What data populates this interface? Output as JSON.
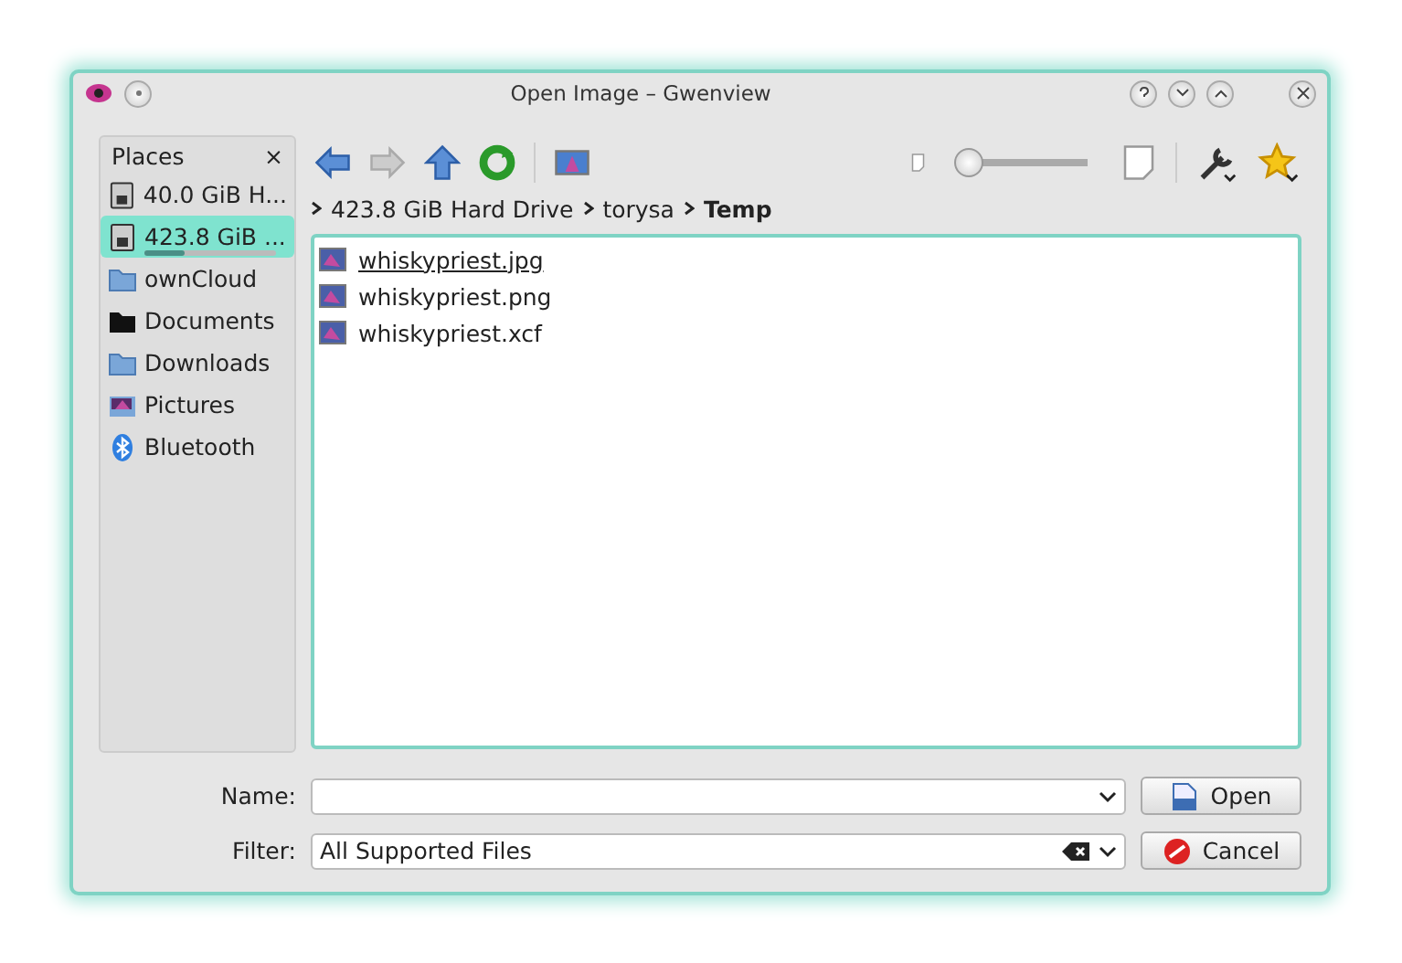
{
  "window": {
    "title": "Open Image – Gwenview"
  },
  "places": {
    "title": "Places",
    "close": "×",
    "items": [
      {
        "label": "40.0 GiB H...",
        "kind": "drive",
        "selected": false
      },
      {
        "label": "423.8 GiB ...",
        "kind": "drive",
        "selected": true,
        "level": 0.3
      },
      {
        "label": "ownCloud",
        "kind": "folder",
        "selected": false
      },
      {
        "label": "Documents",
        "kind": "folder-dark",
        "selected": false
      },
      {
        "label": "Downloads",
        "kind": "folder",
        "selected": false
      },
      {
        "label": "Pictures",
        "kind": "pictures",
        "selected": false
      },
      {
        "label": "Bluetooth",
        "kind": "bluetooth",
        "selected": false
      }
    ]
  },
  "toolbar": {
    "zoom": {
      "level": 0.05
    }
  },
  "breadcrumb": [
    {
      "label": "423.8 GiB Hard Drive",
      "current": false
    },
    {
      "label": "torysa",
      "current": false
    },
    {
      "label": "Temp",
      "current": true
    }
  ],
  "files": [
    {
      "name": "whiskypriest.jpg",
      "hovered": true
    },
    {
      "name": "whiskypriest.png",
      "hovered": false
    },
    {
      "name": "whiskypriest.xcf",
      "hovered": false
    }
  ],
  "name_field": {
    "label": "Name:"
  },
  "filter_field": {
    "label": "Filter:",
    "value": "All Supported Files"
  },
  "buttons": [
    {
      "label": "Open",
      "kind": "open"
    },
    {
      "label": "Cancel",
      "kind": "cancel"
    }
  ]
}
